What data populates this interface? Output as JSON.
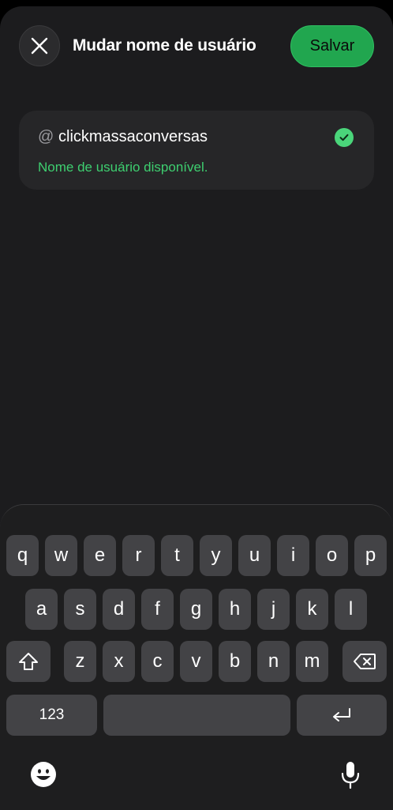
{
  "header": {
    "close_icon": "close-icon",
    "title": "Mudar nome de usuário",
    "save_label": "Salvar"
  },
  "username_field": {
    "prefix": "@",
    "value": "clickmassaconversas",
    "status_icon": "check-circle-icon",
    "status_text": "Nome de usuário disponível."
  },
  "keyboard": {
    "row1": [
      "q",
      "w",
      "e",
      "r",
      "t",
      "y",
      "u",
      "i",
      "o",
      "p"
    ],
    "row2": [
      "a",
      "s",
      "d",
      "f",
      "g",
      "h",
      "j",
      "k",
      "l"
    ],
    "row3": [
      "z",
      "x",
      "c",
      "v",
      "b",
      "n",
      "m"
    ],
    "numbers_label": "123",
    "icons": {
      "shift": "shift-icon",
      "backspace": "backspace-icon",
      "return": "return-icon",
      "emoji": "emoji-icon",
      "mic": "microphone-icon"
    }
  },
  "colors": {
    "accent": "#21a64f",
    "success_text": "#3ecf70",
    "background": "#1c1c1e"
  }
}
